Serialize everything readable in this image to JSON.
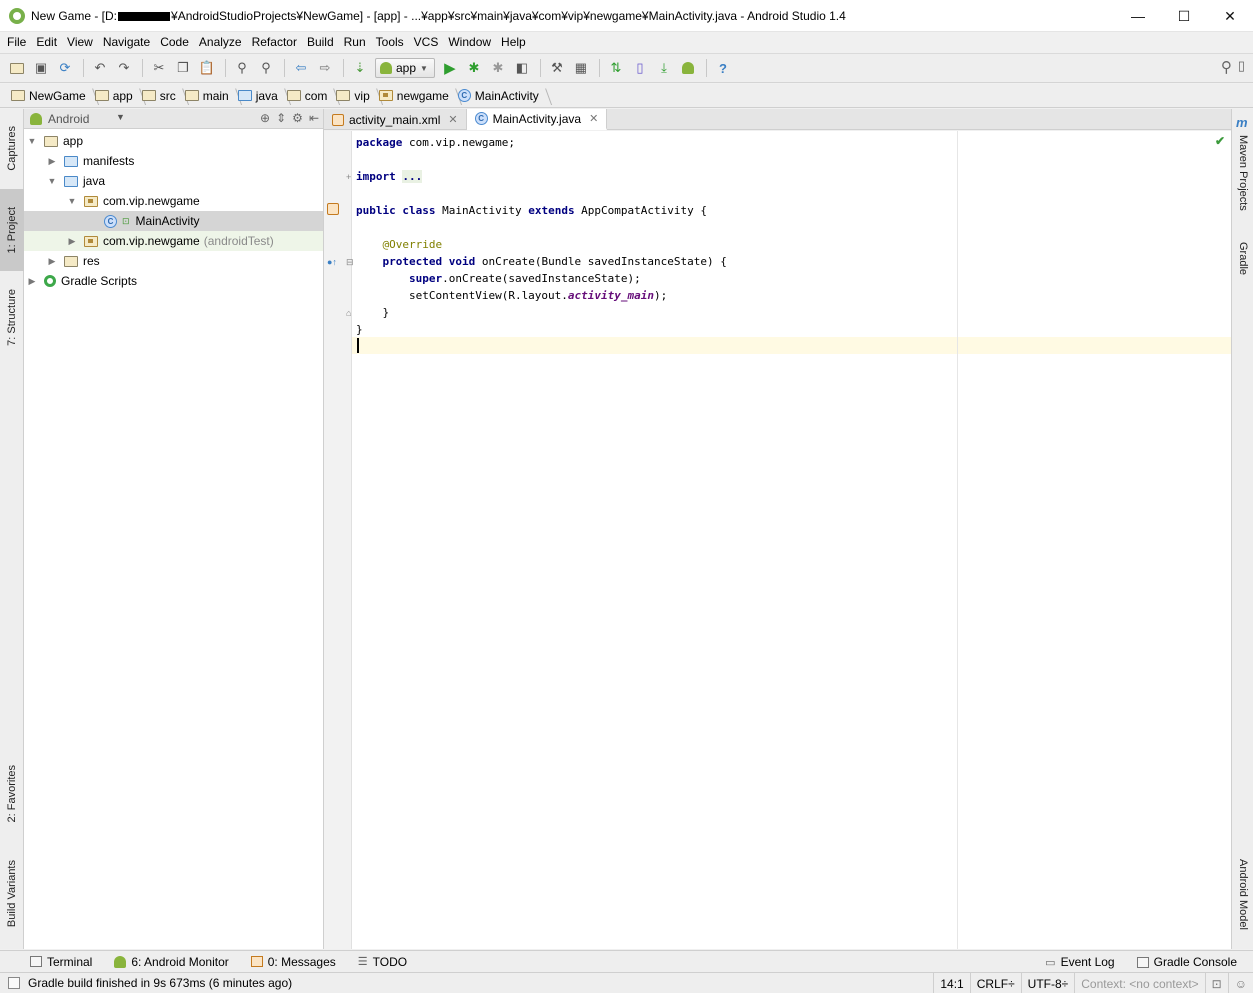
{
  "window": {
    "title_prefix": "New Game - [D:",
    "title_suffix": "¥AndroidStudioProjects¥NewGame] - [app] - ...¥app¥src¥main¥java¥com¥vip¥newgame¥MainActivity.java - Android Studio 1.4",
    "minimize": "—",
    "maximize": "☐",
    "close": "✕"
  },
  "menu": [
    "File",
    "Edit",
    "View",
    "Navigate",
    "Code",
    "Analyze",
    "Refactor",
    "Build",
    "Run",
    "Tools",
    "VCS",
    "Window",
    "Help"
  ],
  "toolbar": {
    "run_config": "app",
    "help": "?"
  },
  "breadcrumb": [
    "NewGame",
    "app",
    "src",
    "main",
    "java",
    "com",
    "vip",
    "newgame",
    "MainActivity"
  ],
  "left_strip": {
    "captures": "Captures",
    "project": "1: Project",
    "structure": "7: Structure",
    "favorites": "2: Favorites",
    "build_variants": "Build Variants"
  },
  "right_strip": {
    "maven": "Maven Projects",
    "maven_icon": "m",
    "gradle": "Gradle",
    "android_model": "Android Model"
  },
  "project_panel": {
    "view_mode": "Android",
    "tree": [
      {
        "label": "app",
        "extra": ""
      },
      {
        "label": "manifests",
        "extra": ""
      },
      {
        "label": "java",
        "extra": ""
      },
      {
        "label": "com.vip.newgame",
        "extra": ""
      },
      {
        "label": "MainActivity",
        "extra": ""
      },
      {
        "label": "com.vip.newgame",
        "extra": "(androidTest)"
      },
      {
        "label": "res",
        "extra": ""
      },
      {
        "label": "Gradle Scripts",
        "extra": ""
      }
    ]
  },
  "editor": {
    "tabs": [
      {
        "label": "activity_main.xml"
      },
      {
        "label": "MainActivity.java"
      }
    ],
    "code": {
      "l1_kw": "package",
      "l1_rest": " com.vip.newgame;",
      "l3_kw": "import",
      "l3_fold": "...",
      "l5_kw1": "public class",
      "l5_mid": " MainActivity ",
      "l5_kw2": "extends",
      "l5_rest": " AppCompatActivity {",
      "l7_ann": "    @Override",
      "l8_kw": "    protected void",
      "l8_rest": " onCreate(Bundle savedInstanceState) {",
      "l9_kw": "        super",
      "l9_rest": ".onCreate(savedInstanceState);",
      "l10_a": "        setContentView(R.layout.",
      "l10_fld": "activity_main",
      "l10_b": ");",
      "l11": "    }",
      "l12": "}"
    }
  },
  "bottom_tools": {
    "terminal": "Terminal",
    "android_monitor": "6: Android Monitor",
    "messages": "0: Messages",
    "todo": "TODO",
    "event_log": "Event Log",
    "gradle_console": "Gradle Console"
  },
  "status": {
    "message": "Gradle build finished in 9s 673ms (6 minutes ago)",
    "position": "14:1",
    "line_sep": "CRLF÷",
    "encoding": "UTF-8÷",
    "context": "Context: <no context>"
  },
  "colors": {
    "keyword": "#000080",
    "annotation": "#808000",
    "field": "#660e7a",
    "current_line": "#fffae3"
  }
}
